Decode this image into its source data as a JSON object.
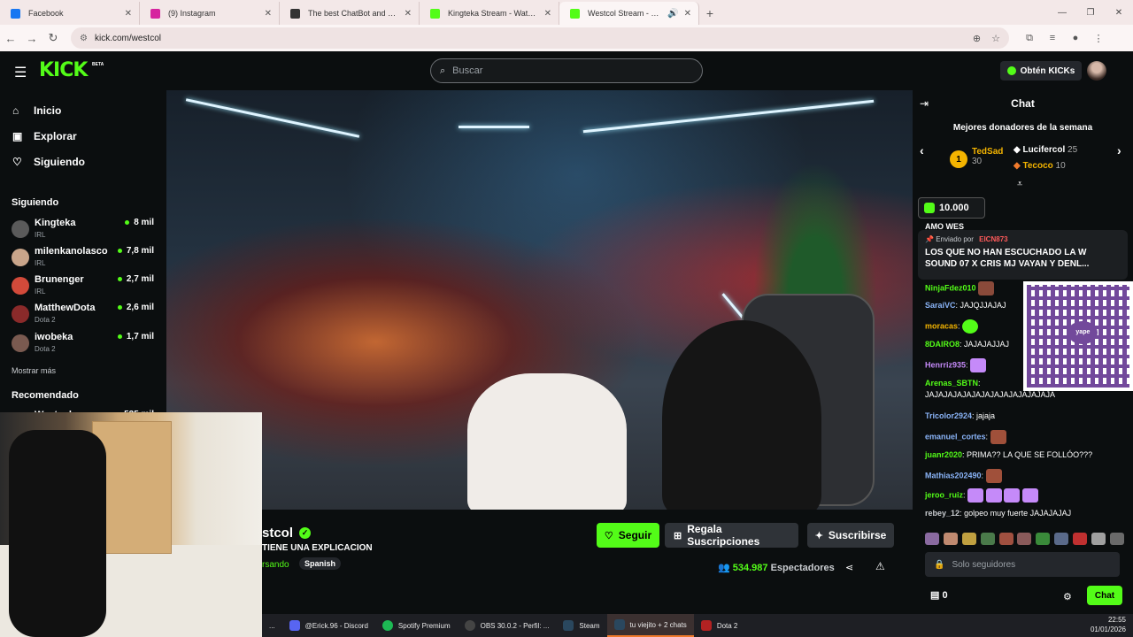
{
  "browser": {
    "tabs": [
      {
        "label": "Facebook",
        "color": "#1877f2"
      },
      {
        "label": "(9) Instagram",
        "color": "#d6249f"
      },
      {
        "label": "The best ChatBot and Widgets",
        "color": "#333333"
      },
      {
        "label": "Kingteka Stream - Watch Live o",
        "color": "#53fc18"
      },
      {
        "label": "Westcol Stream - Watch Liv",
        "color": "#53fc18"
      }
    ],
    "url": "kick.com/westcol"
  },
  "header": {
    "logo": "KICK",
    "beta": "BETA",
    "search_placeholder": "Buscar",
    "kicks_button": "Obtén KICKs"
  },
  "sidebar": {
    "nav": [
      {
        "label": "Inicio",
        "icon": "home-icon"
      },
      {
        "label": "Explorar",
        "icon": "compass-icon"
      },
      {
        "label": "Siguiendo",
        "icon": "heart-icon"
      }
    ],
    "following_heading": "Siguiendo",
    "following": [
      {
        "name": "Kingteka",
        "category": "IRL",
        "viewers": "8 mil",
        "color": "#5a5a5a"
      },
      {
        "name": "milenkanolasco",
        "category": "IRL",
        "viewers": "7,8 mil",
        "color": "#c9a58a"
      },
      {
        "name": "Brunenger",
        "category": "IRL",
        "viewers": "2,7 mil",
        "color": "#d24a3a"
      },
      {
        "name": "MatthewDota",
        "category": "Dota 2",
        "viewers": "2,6 mil",
        "color": "#8a2a2a"
      },
      {
        "name": "iwobeka",
        "category": "Dota 2",
        "viewers": "1,7 mil",
        "color": "#7a5a50"
      }
    ],
    "show_more": "Mostrar más",
    "recommended_heading": "Recomendado",
    "recommended_first": {
      "name": "Westcol",
      "viewers": "535 mil"
    }
  },
  "stream": {
    "name": "stcol",
    "title": "TIENE UNA EXPLICACION",
    "category": "rsando",
    "language": "Spanish",
    "follow_label": "Seguir",
    "gift_label": "Regala Suscripciones",
    "subscribe_label": "Suscribirse",
    "viewers": "534.987",
    "viewers_label": "Espectadores"
  },
  "chat": {
    "title": "Chat",
    "donors_title": "Mejores donadores de la semana",
    "donors": [
      {
        "rank": "1",
        "name": "TedSad",
        "amount": "30"
      },
      {
        "name": "Lucifercol",
        "amount": "25"
      },
      {
        "name": "Tecoco",
        "amount": "10"
      }
    ],
    "kicks_amount": "10.000",
    "partial_text": "AMO WES",
    "pinned": {
      "sent_by": "Enviado por",
      "sender": "EICN873",
      "message": "LOS QUE NO HAN ESCUCHADO LA W SOUND 07 X CRIS MJ VAYAN Y DENL..."
    },
    "messages": [
      {
        "user": "NinjaFdez010",
        "text": "",
        "color": "#53fc18"
      },
      {
        "user": "SaraiVC",
        "text": "JAJQJJAJAJ",
        "color": "#8ab4f8"
      },
      {
        "user": "moracas",
        "text": "",
        "color": "#f4b400"
      },
      {
        "user": "8DAIRO8",
        "text": "JAJAJAJJAJ",
        "color": "#53fc18"
      },
      {
        "user": "Henrriz935",
        "text": "",
        "color": "#c58af9"
      },
      {
        "user": "Arenas_SBTN",
        "text": "JAJAJAJAJAJAJAJAJAJAJAJAJAJA",
        "color": "#53fc18"
      },
      {
        "user": "Tricolor2924",
        "text": "jajaja",
        "color": "#8ab4f8"
      },
      {
        "user": "emanuel_cortes",
        "text": "",
        "color": "#8ab4f8"
      },
      {
        "user": "juanr2020",
        "text": "PRIMA?? LA QUE SE FOLLÓO???",
        "color": "#53fc18"
      },
      {
        "user": "Mathias202490",
        "text": "",
        "color": "#8ab4f8"
      },
      {
        "user": "jeroo_ruiz",
        "text": "",
        "color": "#53fc18"
      },
      {
        "user": "rebey_12",
        "text": "golpeo muy fuerte JAJAJAJAJ",
        "color": "#c9ccd0"
      }
    ],
    "qr_label": "yape",
    "input_placeholder": "Solo seguidores",
    "kicks_count": "0",
    "send_label": "Chat"
  },
  "taskbar": {
    "items": [
      {
        "label": "...",
        "color": "#2a2a2a"
      },
      {
        "label": "@Erick.96 - Discord",
        "color": "#5865f2"
      },
      {
        "label": "Spotify Premium",
        "color": "#1db954"
      },
      {
        "label": "OBS 30.0.2 - Perfil: ...",
        "color": "#444444"
      },
      {
        "label": "Steam",
        "color": "#1b2838"
      },
      {
        "label": "tu viejito + 2 chats",
        "color": "#1b2838"
      },
      {
        "label": "Dota 2",
        "color": "#b22222"
      }
    ],
    "time": "22:55",
    "date": "01/01/2026"
  }
}
